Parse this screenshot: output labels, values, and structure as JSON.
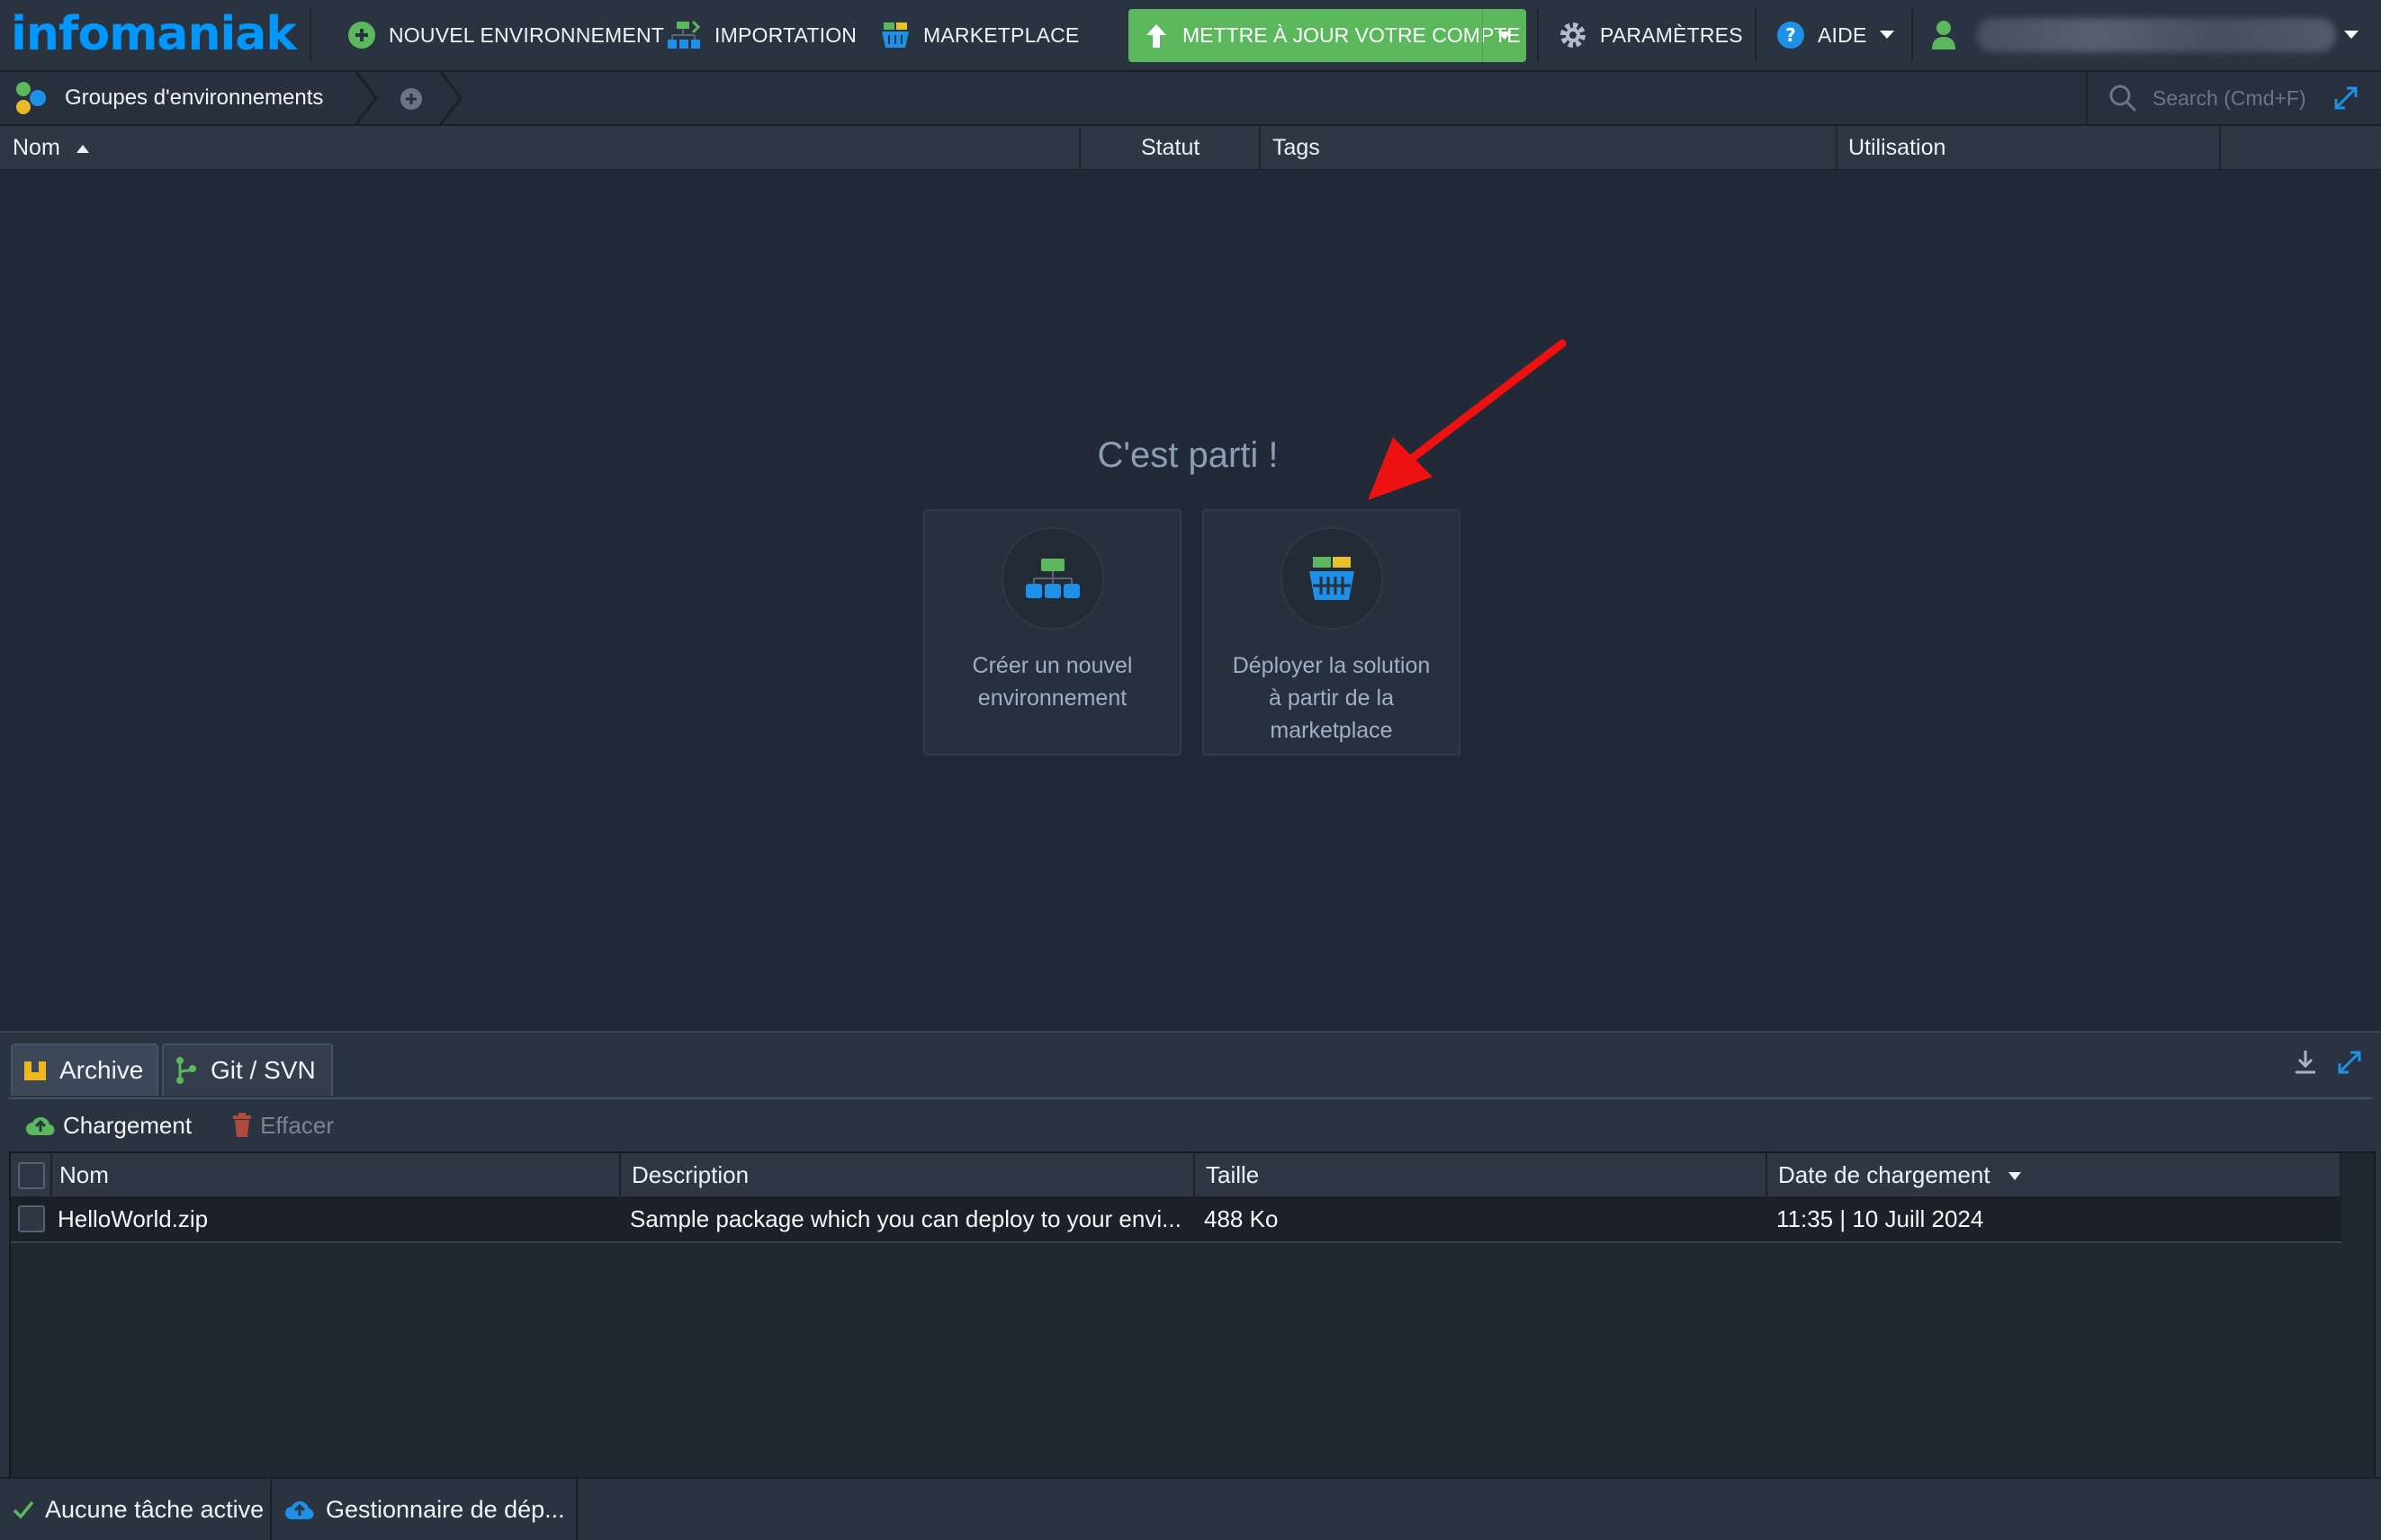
{
  "brand": {
    "logo_text": "infomaniak",
    "color": "#0098ff"
  },
  "topbar": {
    "new_env": "NOUVEL ENVIRONNEMENT",
    "import": "IMPORTATION",
    "marketplace": "MARKETPLACE",
    "upgrade": "METTRE À JOUR VOTRE COMPTE",
    "settings": "PARAMÈTRES",
    "help": "AIDE"
  },
  "breadcrumb": {
    "groups": "Groupes d'environnements"
  },
  "search": {
    "placeholder": "Search (Cmd+F)"
  },
  "env_grid": {
    "columns": {
      "name": "Nom",
      "status": "Statut",
      "tags": "Tags",
      "usage": "Utilisation"
    }
  },
  "empty_state": {
    "title": "C'est parti !",
    "create_card": {
      "line1": "Créer un nouvel",
      "line2": "environnement"
    },
    "deploy_card": {
      "line1": "Déployer la solution",
      "line2": "à partir de la",
      "line3": "marketplace"
    }
  },
  "deployment_panel": {
    "tabs": [
      {
        "label": "Archive"
      },
      {
        "label": "Git / SVN"
      }
    ],
    "toolbar": {
      "upload": "Chargement",
      "delete": "Effacer"
    },
    "columns": {
      "name": "Nom",
      "description": "Description",
      "size": "Taille",
      "date": "Date de chargement"
    },
    "rows": [
      {
        "name": "HelloWorld.zip",
        "description": "Sample package which you can deploy to your envi...",
        "size": "488 Ko",
        "date": "11:35 | 10 Juill 2024"
      }
    ]
  },
  "statusbar": {
    "tasks": "Aucune tâche active",
    "deploy_manager": "Gestionnaire de dép..."
  },
  "colors": {
    "accent_green": "#5cb85c",
    "background": "#212a36",
    "arrow_red": "#ee1111"
  }
}
